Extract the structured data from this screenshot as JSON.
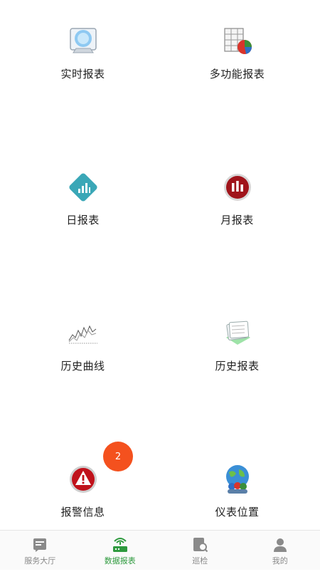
{
  "grid": {
    "items": [
      {
        "label": "实时报表",
        "icon": "realtime-report-icon"
      },
      {
        "label": "多功能报表",
        "icon": "multi-function-report-icon"
      },
      {
        "label": "日报表",
        "icon": "daily-report-icon"
      },
      {
        "label": "月报表",
        "icon": "monthly-report-icon"
      },
      {
        "label": "历史曲线",
        "icon": "history-curve-icon"
      },
      {
        "label": "历史报表",
        "icon": "history-report-icon"
      },
      {
        "label": "报警信息",
        "icon": "alarm-icon"
      },
      {
        "label": "仪表位置",
        "icon": "meter-location-icon"
      }
    ],
    "alarm_badge": "2"
  },
  "tabbar": {
    "tabs": [
      {
        "label": "服务大厅",
        "icon": "service-hall-icon",
        "active": false
      },
      {
        "label": "数据报表",
        "icon": "data-report-icon",
        "active": true
      },
      {
        "label": "巡检",
        "icon": "inspection-icon",
        "active": false
      },
      {
        "label": "我的",
        "icon": "profile-icon",
        "active": false
      }
    ]
  },
  "colors": {
    "active_tab": "#2e9a3e",
    "inactive_tab": "#888888",
    "badge": "#f4511e"
  }
}
